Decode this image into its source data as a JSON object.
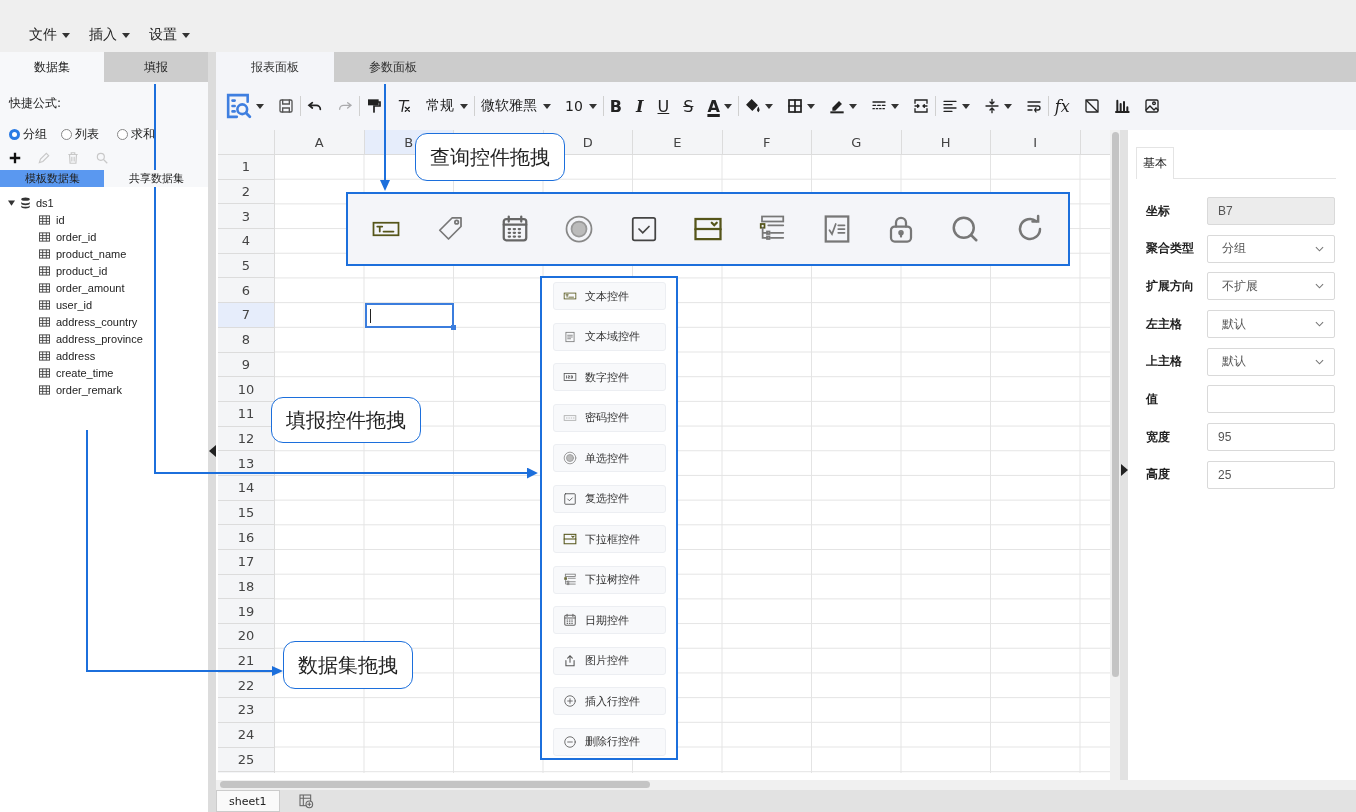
{
  "menu": [
    {
      "label": "文件"
    },
    {
      "label": "插入"
    },
    {
      "label": "设置"
    }
  ],
  "left_panel": {
    "tabs": [
      {
        "label": "数据集",
        "selected": true
      },
      {
        "label": "填报",
        "selected": false
      }
    ],
    "quick_formula": "快捷公式:",
    "formula_options": [
      {
        "label": "分组",
        "selected": true
      },
      {
        "label": "列表",
        "selected": false
      },
      {
        "label": "求和",
        "selected": false
      }
    ],
    "actions": [
      {
        "kind": "add",
        "disabled": false
      },
      {
        "kind": "edit",
        "disabled": true
      },
      {
        "kind": "delete",
        "disabled": true
      },
      {
        "kind": "search",
        "disabled": true
      }
    ],
    "dataset_tabs": [
      {
        "label": "模板数据集",
        "selected": true
      },
      {
        "label": "共享数据集",
        "selected": false
      }
    ],
    "tree": [
      {
        "label": "ds1",
        "expanded": true,
        "children": [
          {
            "label": "id"
          },
          {
            "label": "order_id"
          },
          {
            "label": "product_name"
          },
          {
            "label": "product_id"
          },
          {
            "label": "order_amount"
          },
          {
            "label": "user_id"
          },
          {
            "label": "address_country"
          },
          {
            "label": "address_province"
          },
          {
            "label": "address"
          },
          {
            "label": "create_time"
          },
          {
            "label": "order_remark"
          }
        ]
      }
    ]
  },
  "main_tabs": [
    {
      "label": "报表面板",
      "selected": true
    },
    {
      "label": "参数面板",
      "selected": false
    }
  ],
  "toolbar": [
    [
      {
        "kind": "preview",
        "dropdown": true,
        "disabled": false
      },
      {
        "kind": "save",
        "dropdown": false,
        "disabled": false
      }
    ],
    [
      {
        "kind": "undo",
        "dropdown": false,
        "disabled": false
      },
      {
        "kind": "redo",
        "dropdown": false,
        "disabled": true
      }
    ],
    [
      {
        "kind": "painter",
        "dropdown": false,
        "disabled": false
      },
      {
        "kind": "clear_format",
        "dropdown": false,
        "disabled": false
      },
      {
        "kind": "select",
        "value": "常规"
      }
    ],
    [
      {
        "kind": "select",
        "value": "微软雅黑"
      },
      {
        "kind": "select",
        "value": "10"
      }
    ],
    [
      {
        "kind": "bold",
        "label": "B",
        "dropdown": false,
        "disabled": false
      },
      {
        "kind": "italic",
        "label": "I",
        "dropdown": false,
        "disabled": false
      },
      {
        "kind": "underline",
        "label": "U",
        "dropdown": false,
        "disabled": false
      },
      {
        "kind": "strike",
        "label": "S",
        "dropdown": false,
        "disabled": false
      },
      {
        "kind": "font_color",
        "label": "A",
        "dropdown": true,
        "disabled": false
      }
    ],
    [
      {
        "kind": "fill",
        "dropdown": true,
        "disabled": false
      },
      {
        "kind": "border",
        "dropdown": true,
        "disabled": false
      },
      {
        "kind": "pen",
        "dropdown": true,
        "disabled": false
      },
      {
        "kind": "border_style",
        "dropdown": true,
        "disabled": false
      },
      {
        "kind": "merge",
        "dropdown": false,
        "disabled": false
      }
    ],
    [
      {
        "kind": "align",
        "dropdown": true,
        "disabled": false
      },
      {
        "kind": "valign",
        "dropdown": true,
        "disabled": false
      },
      {
        "kind": "wrap",
        "dropdown": false,
        "disabled": false
      }
    ],
    [
      {
        "kind": "function",
        "label": "fx",
        "dropdown": false,
        "disabled": false
      },
      {
        "kind": "diagonal",
        "dropdown": false,
        "disabled": false
      },
      {
        "kind": "chart",
        "dropdown": false,
        "disabled": false
      },
      {
        "kind": "image",
        "dropdown": false,
        "disabled": false
      }
    ]
  ],
  "grid": {
    "columns": [
      {
        "label": "A",
        "cursor": false
      },
      {
        "label": "B",
        "cursor": true
      },
      {
        "cursor": false
      },
      {
        "label": "D",
        "cursor": false
      },
      {
        "label": "E",
        "cursor": false
      },
      {
        "label": "F",
        "cursor": false
      },
      {
        "label": "G",
        "cursor": false
      },
      {
        "label": "H",
        "cursor": false
      },
      {
        "label": "I",
        "cursor": false
      }
    ],
    "rows": [
      {
        "label": "1",
        "cursor": false
      },
      {
        "label": "2",
        "cursor": false
      },
      {
        "label": "3",
        "cursor": false
      },
      {
        "label": "4",
        "cursor": false
      },
      {
        "label": "5",
        "cursor": false
      },
      {
        "label": "6",
        "cursor": false
      },
      {
        "label": "7",
        "cursor": true
      },
      {
        "label": "8",
        "cursor": false
      },
      {
        "label": "9",
        "cursor": false
      },
      {
        "label": "10",
        "cursor": false
      },
      {
        "label": "11",
        "cursor": false
      },
      {
        "label": "12",
        "cursor": false
      },
      {
        "label": "13",
        "cursor": false
      },
      {
        "label": "14",
        "cursor": false
      },
      {
        "label": "15",
        "cursor": false
      },
      {
        "label": "16",
        "cursor": false
      },
      {
        "label": "17",
        "cursor": false
      },
      {
        "label": "18",
        "cursor": false
      },
      {
        "label": "19",
        "cursor": false
      },
      {
        "label": "20",
        "cursor": false
      },
      {
        "label": "21",
        "cursor": false
      },
      {
        "label": "22",
        "cursor": false
      },
      {
        "label": "23",
        "cursor": false
      },
      {
        "label": "24",
        "cursor": false
      },
      {
        "label": "25",
        "cursor": false
      }
    ]
  },
  "query_controls": [
    {
      "kind": "text"
    },
    {
      "kind": "tag"
    },
    {
      "kind": "date"
    },
    {
      "kind": "radio"
    },
    {
      "kind": "checkbox"
    },
    {
      "kind": "select"
    },
    {
      "kind": "tree"
    },
    {
      "kind": "checklist"
    },
    {
      "kind": "lock"
    },
    {
      "kind": "search"
    },
    {
      "kind": "refresh"
    }
  ],
  "form_controls": [
    {
      "kind": "text",
      "label": "文本控件"
    },
    {
      "kind": "textarea",
      "label": "文本域控件"
    },
    {
      "kind": "number",
      "label": "数字控件"
    },
    {
      "kind": "password",
      "label": "密码控件"
    },
    {
      "kind": "radio",
      "label": "单选控件"
    },
    {
      "kind": "checkbox",
      "label": "复选控件"
    },
    {
      "kind": "select",
      "label": "下拉框控件"
    },
    {
      "kind": "tree",
      "label": "下拉树控件"
    },
    {
      "kind": "date",
      "label": "日期控件"
    },
    {
      "kind": "upload",
      "label": "图片控件"
    },
    {
      "kind": "add_row",
      "label": "插入行控件"
    },
    {
      "kind": "remove_row",
      "label": "删除行控件"
    }
  ],
  "callouts": [
    {
      "label": "查询控件拖拽"
    },
    {
      "label": "填报控件拖拽"
    },
    {
      "label": "数据集拖拽"
    }
  ],
  "right_panel": {
    "tabs": [
      {
        "label": "基本",
        "selected": true
      }
    ],
    "properties": [
      {
        "label": "坐标",
        "kind": "readonly",
        "value": "B7"
      },
      {
        "label": "聚合类型",
        "kind": "select",
        "value": "分组"
      },
      {
        "label": "扩展方向",
        "kind": "select",
        "value": "不扩展"
      },
      {
        "label": "左主格",
        "kind": "select",
        "value": "默认"
      },
      {
        "label": "上主格",
        "kind": "select",
        "value": "默认"
      },
      {
        "label": "值",
        "kind": "input"
      },
      {
        "label": "宽度",
        "kind": "input",
        "value": "95"
      },
      {
        "label": "高度",
        "kind": "input",
        "value": "25"
      }
    ]
  },
  "sheets": [
    {
      "label": "sheet1",
      "selected": true
    }
  ]
}
